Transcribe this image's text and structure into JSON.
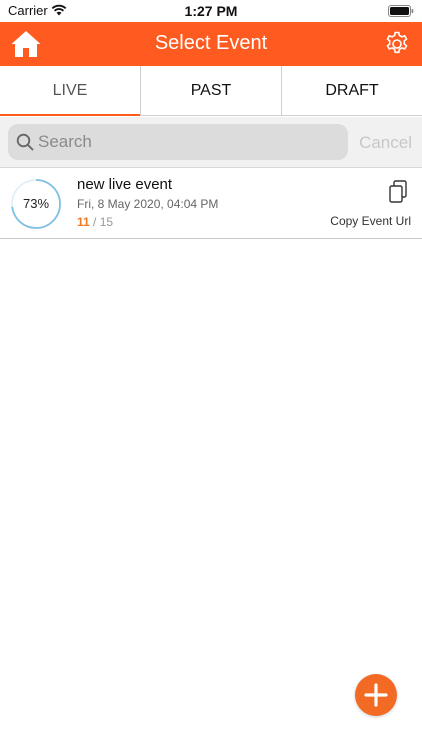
{
  "status_bar": {
    "carrier": "Carrier",
    "time": "1:27 PM"
  },
  "nav": {
    "title": "Select Event",
    "home_icon": "home-icon",
    "settings_icon": "gear-icon",
    "background_color": "#ff5a1f"
  },
  "tabs": [
    {
      "label": "LIVE",
      "selected": true
    },
    {
      "label": "PAST",
      "selected": false
    },
    {
      "label": "DRAFT",
      "selected": false
    }
  ],
  "search": {
    "placeholder": "Search",
    "value": "",
    "cancel_label": "Cancel"
  },
  "events": [
    {
      "progress_label": "73%",
      "progress_fraction": 0.73,
      "name": "new live event",
      "date": "Fri, 8 May 2020, 04:04 PM",
      "count_done": "11",
      "count_separator": " / ",
      "count_total": "15",
      "copy_label": "Copy Event Url"
    }
  ],
  "fab": {
    "icon": "plus-icon",
    "color": "#f26a24"
  },
  "colors": {
    "accent": "#ff5a1f",
    "progress_ring": "#7fbfe0",
    "count_done": "#f07a24"
  }
}
